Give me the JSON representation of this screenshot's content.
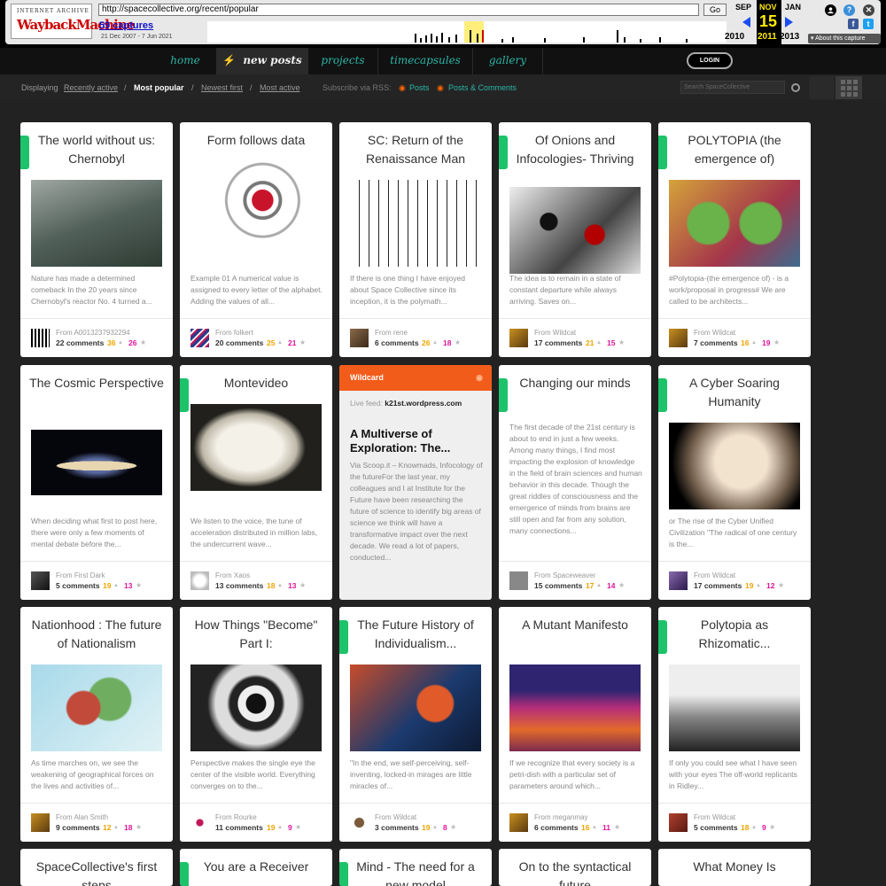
{
  "wayback": {
    "logo_top": "INTERNET ARCHIVE",
    "logo_main": "WaybackMachine",
    "url": "http://spacecollective.org/recent/popular",
    "go": "Go",
    "captures": "59 captures",
    "range": "21 Dec 2007 - 7 Jun 2021",
    "prev_month": "SEP",
    "cur_month": "NOV",
    "next_month": "JAN",
    "prev_year": "2010",
    "cur_day": "15",
    "cur_year": "2011",
    "next_year": "2013",
    "about": "▾ About this capture"
  },
  "nav": {
    "items": [
      {
        "label": "home"
      },
      {
        "label": "new posts"
      },
      {
        "label": "projects"
      },
      {
        "label": "timecapsules"
      },
      {
        "label": "gallery"
      }
    ],
    "login": "LOGIN"
  },
  "subbar": {
    "displaying": "Displaying",
    "recently_active": "Recently active",
    "most_popular": "Most popular",
    "newest_first": "Newest first",
    "most_active": "Most active",
    "subscribe": "Subscribe via RSS:",
    "posts": "Posts",
    "posts_comments": "Posts & Comments",
    "search_placeholder": "Search SpaceCollective"
  },
  "cards": [
    {
      "title": "The world without us: Chernobyl",
      "excerpt": "Nature has made a determined comeback In the 20 years since Chernobyl's reactor No. 4 turned a...",
      "from": "From A0013237932294",
      "comments": "22 comments",
      "up": "36",
      "down": "26",
      "flag": true
    },
    {
      "title": "Form follows data",
      "excerpt": "Example 01 A numerical value is assigned to every letter of the alphabet. Adding the values of all...",
      "from": "From folkert",
      "comments": "20 comments",
      "up": "25",
      "down": "21",
      "flag": false
    },
    {
      "title": "SC: Return of the Renaissance Man",
      "excerpt": "If there is one thing I have enjoyed about Space Collective since its inception, it is the polymath...",
      "from": "From rene",
      "comments": "6 comments",
      "up": "26",
      "down": "18",
      "flag": false
    },
    {
      "title": "Of Onions and Infocologies- Thriving",
      "excerpt": "The idea is to remain in a state of constant departure while always arriving. Saves on...",
      "from": "From Wildcat",
      "comments": "17 comments",
      "up": "21",
      "down": "15",
      "flag": true
    },
    {
      "title": "POLYTOPIA (the emergence of)",
      "excerpt": "#Polytopia-(the emergence of) - is a work/proposal in progress# We are called to be architects...",
      "from": "From Wildcat",
      "comments": "7 comments",
      "up": "16",
      "down": "19",
      "flag": true
    },
    {
      "title": "The Cosmic Perspective",
      "excerpt": "When deciding what first to post here, there were only a few moments of mental debate before the...",
      "from": "From First Dark",
      "comments": "5 comments",
      "up": "19",
      "down": "13",
      "flag": false
    },
    {
      "title": "Montevideo",
      "excerpt": "We listen to the voice, the tune of acceleration distributed in million labs, the undercurrent wave...",
      "from": "From Xaos",
      "comments": "13 comments",
      "up": "18",
      "down": "13",
      "flag": true
    },
    {
      "title": "Changing our minds",
      "excerpt": "The first decade of the 21st century is about to end in just a few weeks. Among many things, I find most impacting the explosion of knowledge in the field of brain sciences and human behavior in this decade. Though the great riddles of consciousness and the emergence of minds from brains are still open and far from any solution, many connections...",
      "from": "From Spaceweaver",
      "comments": "15 comments",
      "up": "17",
      "down": "14",
      "flag": true
    },
    {
      "title": "A Cyber Soaring Humanity",
      "excerpt": "or The rise of the Cyber Unified Civilization \"The radical of one century is the...",
      "from": "From Wildcat",
      "comments": "17 comments",
      "up": "19",
      "down": "12",
      "flag": true
    },
    {
      "title": "Nationhood : The future of Nationalism",
      "excerpt": "As time marches on, we see the weakening of geographical forces on the lives and activities of...",
      "from": "From Alan Smith",
      "comments": "9 comments",
      "up": "12",
      "down": "18",
      "flag": false
    },
    {
      "title": "How Things \"Become\" Part I:",
      "excerpt": "Perspective makes the single eye the center of the visible world. Everything converges on to the...",
      "from": "From Rourke",
      "comments": "11 comments",
      "up": "19",
      "down": "9",
      "flag": false
    },
    {
      "title": "The Future History of Individualism...",
      "excerpt": "\"In the end, we self-perceiving, self-inventing, locked-in mirages are little miracles of...",
      "from": "From Wildcat",
      "comments": "3 comments",
      "up": "19",
      "down": "8",
      "flag": true
    },
    {
      "title": "A Mutant Manifesto",
      "excerpt": "If we recognize that every society is a petri-dish with a particular set of parameters around which...",
      "from": "From meganmay",
      "comments": "6 comments",
      "up": "16",
      "down": "11",
      "flag": false
    },
    {
      "title": "Polytopia as Rhizomatic...",
      "excerpt": "If only you could see what I have seen with your eyes The off-world replicants in Ridley...",
      "from": "From Wildcat",
      "comments": "5 comments",
      "up": "18",
      "down": "9",
      "flag": true
    },
    {
      "title": "SpaceCollective's first steps",
      "flag": false
    },
    {
      "title": "You are a Receiver",
      "flag": true
    },
    {
      "title": "Mind - The need for a new model",
      "flag": true
    },
    {
      "title": "On to the syntactical future",
      "flag": false
    },
    {
      "title": "What Money Is",
      "flag": false
    }
  ],
  "wildcard": {
    "label": "Wildcard",
    "feed_label": "Live feed:",
    "feed_site": "k21st.wordpress.com",
    "title": "A Multiverse of Exploration: The...",
    "text": "Via Scoop.it – Knowmads, Infocology of the futureFor the last year, my colleagues and I at Institute for the Future have been researching the future of science to identify big areas of science we think will have a transformative impact over the next decade. We read a lot of papers, conducted..."
  },
  "colors": {
    "flag": "#1cc36a",
    "up": "#f0a400",
    "down": "#e0149a",
    "nav_link": "#2ab5a6",
    "wildcard": "#f25c1a"
  }
}
